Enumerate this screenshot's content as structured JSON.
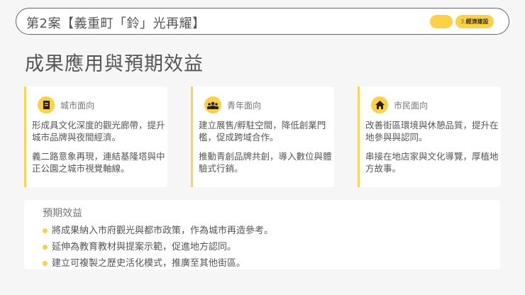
{
  "header": {
    "title": "第2案【義重町「鈴」光再耀】",
    "badge_num": "3.",
    "badge_label": "經濟建設"
  },
  "heading": "成果應用與預期效益",
  "cards": [
    {
      "icon": "building-icon",
      "label": "城市面向",
      "paragraphs": [
        "形成具文化深度的觀光廊帶，提升城市品牌與夜間經濟。",
        "義二路意象再現，連結基隆塔與中正公園之城市視覺軸線。"
      ]
    },
    {
      "icon": "people-group-icon",
      "label": "青年面向",
      "paragraphs": [
        "建立展售/孵駐空間，降低創業門檻，促成跨域合作。",
        "推動青創品牌共創，導入數位與體驗式行銷。"
      ]
    },
    {
      "icon": "home-icon",
      "label": "市民面向",
      "paragraphs": [
        "改善街區環境與休憩品質，提升在地參與與認同。",
        "串接在地店家與文化導覽，厚植地方故事。"
      ]
    }
  ],
  "benefits": {
    "title": "預期效益",
    "items": [
      "將成果納入市府觀光與都市政策，作為城市再造參考。",
      "延伸為教育教材與提案示範，促進地方認同。",
      "建立可複製之歷史活化模式，推廣至其他街區。"
    ]
  },
  "colors": {
    "accent": "#fcd144"
  }
}
